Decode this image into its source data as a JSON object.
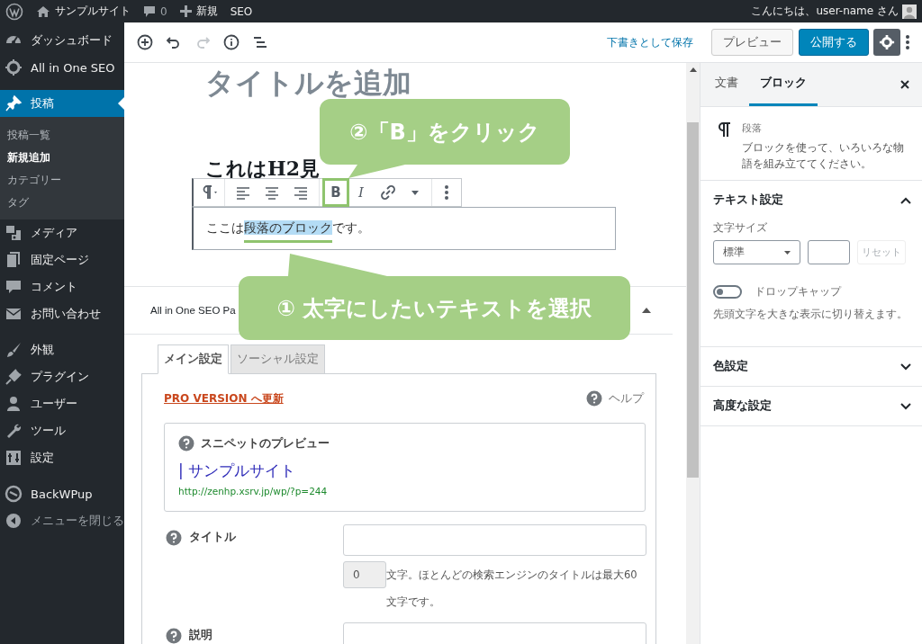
{
  "admin_bar": {
    "site": "サンプルサイト",
    "comments": "0",
    "new": "新規",
    "seo": "SEO",
    "greeting": "こんにちは、user-name さん"
  },
  "sidebar": {
    "items": [
      {
        "label": "ダッシュボード",
        "kind": "menu",
        "selected": false
      },
      {
        "label": "All in One SEO",
        "kind": "menu",
        "selected": false
      },
      {
        "label": "投稿",
        "kind": "menu",
        "selected": true,
        "children": [
          {
            "label": "投稿一覧",
            "selected": false
          },
          {
            "label": "新規追加",
            "selected": true
          },
          {
            "label": "カテゴリー",
            "selected": false
          },
          {
            "label": "タグ",
            "selected": false
          }
        ]
      },
      {
        "label": "メディア",
        "kind": "menu",
        "selected": false
      },
      {
        "label": "固定ページ",
        "kind": "menu",
        "selected": false
      },
      {
        "label": "コメント",
        "kind": "menu",
        "selected": false
      },
      {
        "label": "お問い合わせ",
        "kind": "menu",
        "selected": false
      },
      {
        "label": "外観",
        "kind": "menu",
        "selected": false
      },
      {
        "label": "プラグイン",
        "kind": "menu",
        "selected": false
      },
      {
        "label": "ユーザー",
        "kind": "menu",
        "selected": false
      },
      {
        "label": "ツール",
        "kind": "menu",
        "selected": false
      },
      {
        "label": "設定",
        "kind": "menu",
        "selected": false
      },
      {
        "label": "BackWPup",
        "kind": "menu",
        "selected": false
      },
      {
        "label": "メニューを閉じる",
        "kind": "collapse",
        "selected": false
      }
    ]
  },
  "header": {
    "tools": [
      {
        "disabled": false
      },
      {
        "disabled": false
      },
      {
        "disabled": true
      },
      {
        "disabled": false
      },
      {
        "disabled": false
      }
    ],
    "save_draft": "下書きとして保存",
    "preview": "プレビュー",
    "publish": "公開する"
  },
  "editor": {
    "title_placeholder": "タイトルを追加",
    "heading": "これはH2見",
    "block_toolbar": {
      "bold": "B",
      "bold_highlighted": true,
      "italic": "I"
    },
    "paragraph": [
      {
        "text": "ここは",
        "selected": false
      },
      {
        "text": "段落のブロック",
        "selected": true
      },
      {
        "text": "です。",
        "selected": false
      }
    ]
  },
  "seo_box": {
    "title": "All in One SEO Pa",
    "tabs": [
      {
        "label": "メイン設定",
        "selected": true
      },
      {
        "label": "ソーシャル設定",
        "selected": false
      }
    ],
    "pro_link": "PRO VERSION へ更新",
    "help": "ヘルプ",
    "snippet": {
      "heading": "スニペットのプレビュー",
      "title": "| サンプルサイト",
      "url": "http://zenhp.xsrv.jp/wp/?p=244"
    },
    "title_label": "タイトル",
    "counter": "0",
    "counter_note": "文字。ほとんどの検索エンジンのタイトルは最大60文字です。",
    "description_label": "説明"
  },
  "panel": {
    "tabs": [
      {
        "label": "文書",
        "selected": false
      },
      {
        "label": "ブロック",
        "selected": true
      }
    ],
    "block": {
      "name": "段落",
      "description": "ブロックを使って、いろいろな物語を組み立ててください。"
    },
    "sections": [
      {
        "title": "テキスト設定",
        "expanded": true,
        "font_size_label": "文字サイズ",
        "font_size": "標準",
        "reset": {
          "label": "リセット",
          "disabled": true
        },
        "drop_cap": {
          "label": "ドロップキャップ",
          "on": false
        },
        "help": "先頭文字を大きな表示に切り替えます。"
      },
      {
        "title": "色設定",
        "expanded": false
      },
      {
        "title": "高度な設定",
        "expanded": false
      }
    ]
  },
  "callouts": [
    {
      "text": "②「B」をクリック"
    },
    {
      "text": "① 太字にしたいテキストを選択"
    }
  ]
}
